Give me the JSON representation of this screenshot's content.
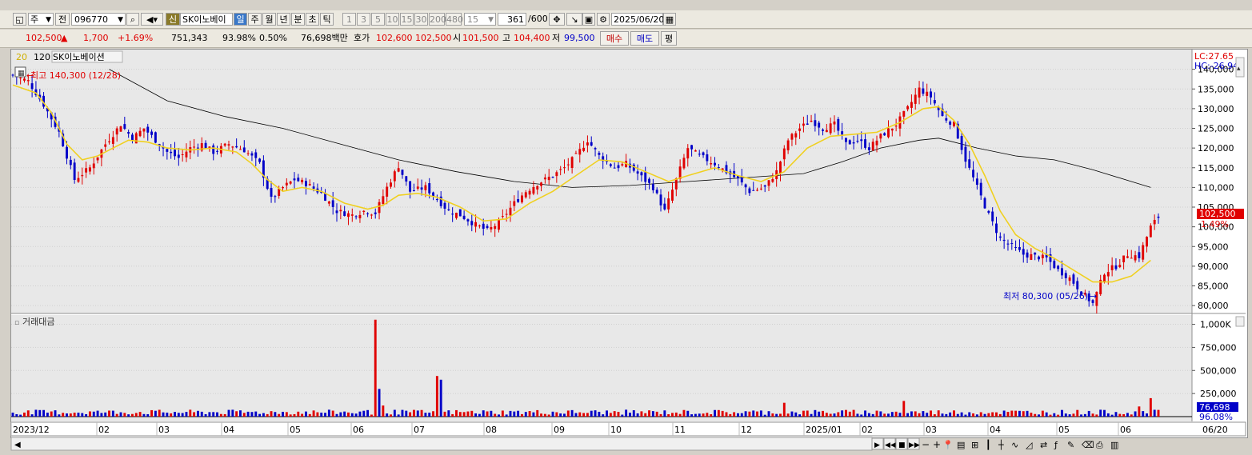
{
  "toolbar": {
    "period_type": "주",
    "prev_label": "전",
    "code": "096770",
    "new_badge": "신",
    "stock_name": "SK이노베이",
    "periods": [
      "일",
      "주",
      "월",
      "년",
      "분",
      "초",
      "틱"
    ],
    "active_period": "일",
    "intervals": [
      "1",
      "3",
      "5",
      "10",
      "15",
      "30",
      "200",
      "480"
    ],
    "interval_value": "15",
    "count_value": "361",
    "count_total": "/600",
    "date_value": "2025/06/20"
  },
  "quote": {
    "price": "102,500",
    "change": "1,700",
    "change_pct": "+1.69%",
    "volume": "751,343",
    "ratio1": "93.98%",
    "ratio2": "0.50%",
    "amount": "76,698백만",
    "ask_label": "호가",
    "ask_price": "102,600",
    "bid_price": "102,500",
    "open_label": "시",
    "open_value": "101,500",
    "high_label": "고",
    "high_value": "104,400",
    "low_label": "저",
    "low_value": "99,500",
    "buy_label": "매수",
    "sell_label": "매도",
    "avg_label": "평"
  },
  "chart_data": {
    "type": "candlestick",
    "legend": {
      "ma_short": "20",
      "ma_long": "120",
      "name": "SK이노베이션"
    },
    "colors": {
      "up": "#e00000",
      "down": "#0000c8",
      "ma20": "#f0d020",
      "ma120": "#000000",
      "accent": "#e00000"
    },
    "ylim": [
      78000,
      145000
    ],
    "y_ticks": [
      "140,000",
      "135,000",
      "130,000",
      "125,000",
      "120,000",
      "115,000",
      "110,000",
      "105,000",
      "100,000",
      "95,000",
      "90,000",
      "85,000",
      "80,000"
    ],
    "y_tick_values": [
      140000,
      135000,
      130000,
      125000,
      120000,
      115000,
      110000,
      105000,
      100000,
      95000,
      90000,
      85000,
      80000
    ],
    "lc_label": "LC:27.65",
    "hc_label": "HC:-26.94",
    "current_price_label": "102,500",
    "current_price": 102500,
    "current_pct_label": "1.49%",
    "annotation_high": "최고 140,300 (12/28)",
    "annotation_low": "최저 80,300 (05/26)",
    "x_labels": [
      "2023/12",
      "02",
      "03",
      "04",
      "05",
      "06",
      "07",
      "08",
      "09",
      "10",
      "11",
      "12",
      "2025/01",
      "02",
      "03",
      "04",
      "05",
      "06"
    ],
    "end_date_label": "06/20",
    "close_points": [
      [
        0,
        138500
      ],
      [
        4,
        137000
      ],
      [
        8,
        131000
      ],
      [
        12,
        124000
      ],
      [
        16,
        112000
      ],
      [
        20,
        115000
      ],
      [
        24,
        121000
      ],
      [
        28,
        126000
      ],
      [
        31,
        122500
      ],
      [
        34,
        125000
      ],
      [
        37,
        122000
      ],
      [
        40,
        119000
      ],
      [
        43,
        117500
      ],
      [
        46,
        120000
      ],
      [
        49,
        121000
      ],
      [
        52,
        119000
      ],
      [
        56,
        121000
      ],
      [
        60,
        119500
      ],
      [
        64,
        116000
      ],
      [
        67,
        107000
      ],
      [
        70,
        110000
      ],
      [
        73,
        112000
      ],
      [
        76,
        111000
      ],
      [
        80,
        108500
      ],
      [
        84,
        104000
      ],
      [
        88,
        103000
      ],
      [
        91,
        104000
      ],
      [
        94,
        103500
      ],
      [
        97,
        110000
      ],
      [
        100,
        115500
      ],
      [
        103,
        109000
      ],
      [
        107,
        110000
      ],
      [
        110,
        107000
      ],
      [
        113,
        104000
      ],
      [
        116,
        103000
      ],
      [
        120,
        100500
      ],
      [
        123,
        99000
      ],
      [
        126,
        101000
      ],
      [
        130,
        106000
      ],
      [
        133,
        109000
      ],
      [
        136,
        111000
      ],
      [
        140,
        113000
      ],
      [
        143,
        115000
      ],
      [
        146,
        118000
      ],
      [
        149,
        122000
      ],
      [
        152,
        118000
      ],
      [
        156,
        115000
      ],
      [
        159,
        116000
      ],
      [
        162,
        113500
      ],
      [
        166,
        110000
      ],
      [
        169,
        104000
      ],
      [
        172,
        112000
      ],
      [
        175,
        120000
      ],
      [
        178,
        118000
      ],
      [
        182,
        116000
      ],
      [
        185,
        114000
      ],
      [
        188,
        112000
      ],
      [
        191,
        109000
      ],
      [
        195,
        110000
      ],
      [
        198,
        114000
      ],
      [
        201,
        122000
      ],
      [
        204,
        125000
      ],
      [
        207,
        127000
      ],
      [
        210,
        125000
      ],
      [
        213,
        126000
      ],
      [
        216,
        121000
      ],
      [
        219,
        122000
      ],
      [
        222,
        120000
      ],
      [
        225,
        123000
      ],
      [
        229,
        126000
      ],
      [
        232,
        130000
      ],
      [
        235,
        135000
      ],
      [
        238,
        133000
      ],
      [
        241,
        128000
      ],
      [
        244,
        126000
      ],
      [
        247,
        117000
      ],
      [
        250,
        110000
      ],
      [
        253,
        103000
      ],
      [
        256,
        97000
      ],
      [
        259,
        95000
      ],
      [
        262,
        93000
      ],
      [
        265,
        92500
      ],
      [
        268,
        92000
      ],
      [
        271,
        89000
      ],
      [
        274,
        87000
      ],
      [
        277,
        83500
      ],
      [
        280,
        80500
      ],
      [
        283,
        88500
      ],
      [
        286,
        90000
      ],
      [
        289,
        93000
      ],
      [
        292,
        92500
      ],
      [
        295,
        100000
      ],
      [
        297,
        102500
      ]
    ],
    "ma20_points": [
      [
        0,
        136000
      ],
      [
        6,
        134000
      ],
      [
        10,
        129000
      ],
      [
        14,
        121000
      ],
      [
        18,
        117000
      ],
      [
        22,
        118000
      ],
      [
        26,
        120000
      ],
      [
        30,
        122000
      ],
      [
        35,
        121500
      ],
      [
        40,
        120000
      ],
      [
        46,
        119500
      ],
      [
        52,
        120000
      ],
      [
        58,
        119000
      ],
      [
        62,
        116000
      ],
      [
        66,
        112000
      ],
      [
        70,
        109000
      ],
      [
        75,
        110000
      ],
      [
        80,
        109000
      ],
      [
        86,
        106000
      ],
      [
        92,
        104500
      ],
      [
        96,
        105500
      ],
      [
        100,
        108000
      ],
      [
        105,
        108500
      ],
      [
        110,
        107500
      ],
      [
        116,
        105000
      ],
      [
        122,
        101500
      ],
      [
        128,
        102000
      ],
      [
        134,
        106000
      ],
      [
        140,
        109000
      ],
      [
        146,
        113000
      ],
      [
        152,
        117000
      ],
      [
        158,
        116500
      ],
      [
        164,
        114000
      ],
      [
        170,
        111500
      ],
      [
        175,
        113000
      ],
      [
        182,
        115000
      ],
      [
        188,
        113000
      ],
      [
        194,
        111500
      ],
      [
        200,
        114000
      ],
      [
        206,
        120000
      ],
      [
        212,
        123000
      ],
      [
        218,
        123500
      ],
      [
        224,
        124000
      ],
      [
        230,
        126500
      ],
      [
        236,
        130000
      ],
      [
        240,
        130500
      ],
      [
        244,
        127000
      ],
      [
        248,
        121000
      ],
      [
        252,
        113000
      ],
      [
        256,
        104000
      ],
      [
        260,
        98000
      ],
      [
        265,
        94500
      ],
      [
        270,
        92000
      ],
      [
        275,
        89000
      ],
      [
        280,
        86000
      ],
      [
        285,
        86000
      ],
      [
        290,
        87500
      ],
      [
        295,
        91500
      ]
    ],
    "ma120_points": [
      [
        25,
        140000
      ],
      [
        40,
        132000
      ],
      [
        55,
        128000
      ],
      [
        70,
        125000
      ],
      [
        85,
        121000
      ],
      [
        100,
        117000
      ],
      [
        115,
        114000
      ],
      [
        130,
        111500
      ],
      [
        145,
        110000
      ],
      [
        160,
        110500
      ],
      [
        175,
        111500
      ],
      [
        190,
        112500
      ],
      [
        205,
        113500
      ],
      [
        215,
        116500
      ],
      [
        225,
        120000
      ],
      [
        235,
        122000
      ],
      [
        240,
        122500
      ],
      [
        250,
        120000
      ],
      [
        260,
        118000
      ],
      [
        270,
        117000
      ],
      [
        280,
        114500
      ],
      [
        290,
        111500
      ],
      [
        295,
        110000
      ]
    ],
    "volume": {
      "label": "거래대금",
      "y_ticks": [
        "1,000K",
        "750,000",
        "500,000",
        "250,000"
      ],
      "y_tick_values": [
        1000000,
        750000,
        500000,
        250000
      ],
      "ylim": [
        0,
        1100000
      ],
      "current_label": "76,698",
      "pct_label": "96.08%",
      "spikes": [
        {
          "idx": 94,
          "value": 1050000,
          "dir": "up"
        },
        {
          "idx": 110,
          "value": 440000,
          "dir": "up"
        },
        {
          "idx": 111,
          "value": 400000,
          "dir": "down"
        },
        {
          "idx": 95,
          "value": 300000,
          "dir": "down"
        },
        {
          "idx": 96,
          "value": 120000,
          "dir": "up"
        },
        {
          "idx": 200,
          "value": 150000,
          "dir": "up"
        },
        {
          "idx": 231,
          "value": 170000,
          "dir": "up"
        },
        {
          "idx": 295,
          "value": 200000,
          "dir": "up"
        },
        {
          "idx": 292,
          "value": 110000,
          "dir": "up"
        }
      ]
    }
  }
}
